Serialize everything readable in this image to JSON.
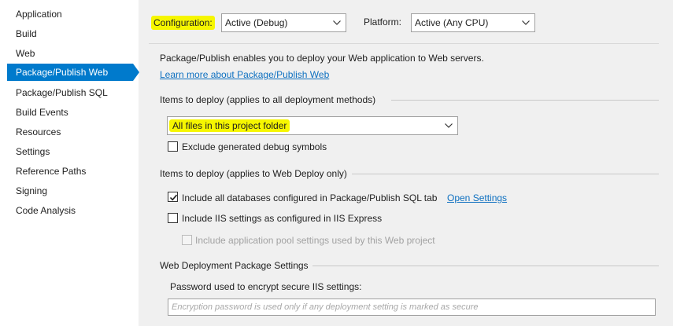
{
  "sidebar": {
    "items": [
      {
        "label": "Application"
      },
      {
        "label": "Build"
      },
      {
        "label": "Web"
      },
      {
        "label": "Package/Publish Web"
      },
      {
        "label": "Package/Publish SQL"
      },
      {
        "label": "Build Events"
      },
      {
        "label": "Resources"
      },
      {
        "label": "Settings"
      },
      {
        "label": "Reference Paths"
      },
      {
        "label": "Signing"
      },
      {
        "label": "Code Analysis"
      }
    ],
    "active_index": 3
  },
  "header": {
    "configuration_label": "Configuration:",
    "configuration_value": "Active (Debug)",
    "platform_label": "Platform:",
    "platform_value": "Active (Any CPU)"
  },
  "intro": {
    "description": "Package/Publish enables you to deploy your Web application to Web servers.",
    "learn_more_link": "Learn more about Package/Publish Web"
  },
  "items_all": {
    "heading": "Items to deploy (applies to all deployment methods)",
    "dropdown_value": "All files in this project folder",
    "exclude_debug_label": "Exclude generated debug symbols",
    "exclude_debug_checked": false
  },
  "items_webdeploy": {
    "heading": "Items to deploy (applies to Web Deploy only)",
    "include_db_label": "Include all databases configured in Package/Publish SQL tab",
    "include_db_checked": true,
    "open_settings_link": "Open Settings",
    "include_iis_label": "Include IIS settings as configured in IIS Express",
    "include_iis_checked": false,
    "include_apppool_label": "Include application pool settings used by this Web project",
    "include_apppool_checked": false,
    "include_apppool_enabled": false
  },
  "package_settings": {
    "heading": "Web Deployment Package Settings",
    "password_label": "Password used to encrypt secure IIS settings:",
    "password_placeholder": "Encryption password is used only if any deployment setting is marked as secure"
  },
  "colors": {
    "accent": "#007acc",
    "highlight": "#f6f600",
    "link": "#0e70c0",
    "pane_background": "#f0f0f0"
  }
}
